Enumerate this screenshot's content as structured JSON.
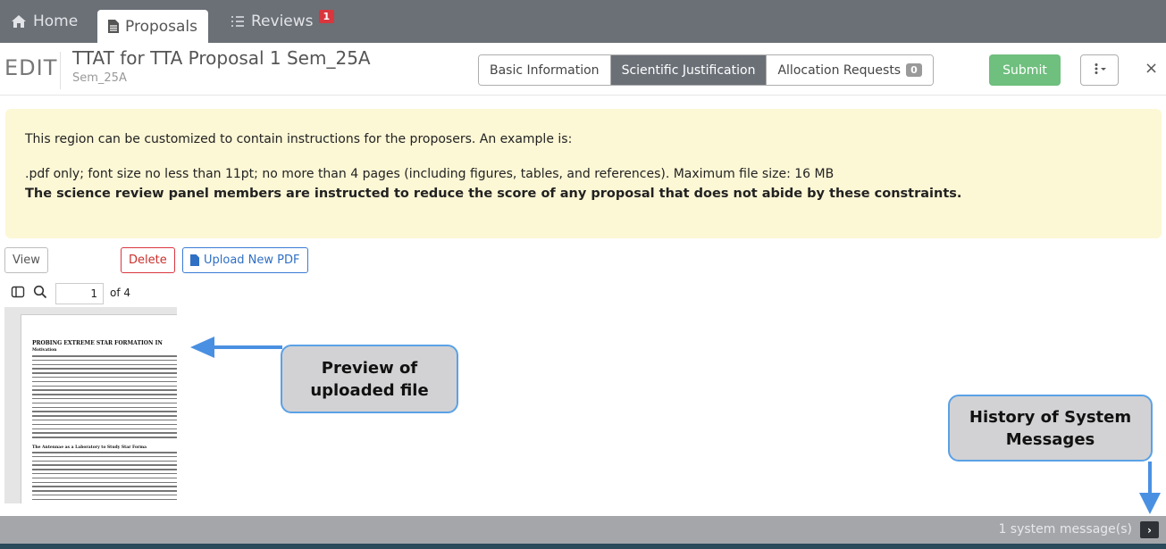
{
  "nav": {
    "tabs": [
      {
        "label": "Home",
        "icon": "home-icon"
      },
      {
        "label": "Proposals",
        "icon": "document-icon"
      },
      {
        "label": "Reviews",
        "icon": "list-icon",
        "badge": "1"
      }
    ]
  },
  "header": {
    "mode_label": "EDIT",
    "title": "TTAT for TTA Proposal 1 Sem_25A",
    "subtitle": "Sem_25A",
    "sections": [
      {
        "label": "Basic Information"
      },
      {
        "label": "Scientific Justification",
        "active": true
      },
      {
        "label": "Allocation Requests",
        "badge": "0"
      }
    ],
    "submit_label": "Submit",
    "close_symbol": "×"
  },
  "instructions": {
    "line1": "This region can be customized to contain instructions for the proposers. An example is:",
    "line2": ".pdf only; font size no less than 11pt; no more than 4 pages (including figures, tables, and references). Maximum file size: 16 MB",
    "line3": "The science review panel members are instructed to reduce the score of any proposal that does not abide by these constraints."
  },
  "actions": {
    "view_label": "View",
    "delete_label": "Delete",
    "upload_label": "Upload New PDF"
  },
  "pdf_viewer": {
    "current_page": "1",
    "page_count_label": "of 4",
    "preview": {
      "heading": "PROBING EXTREME STAR FORMATION IN",
      "section1": "Motivation",
      "section2": "The Antennae as a Laboratory to Study Star Forma"
    }
  },
  "annotations": {
    "preview_callout": "Preview of uploaded file",
    "history_callout": "History of System Messages",
    "arrow_color": "#4a90e2"
  },
  "status_bar": {
    "message": "1 system message(s)",
    "expand_symbol": "›"
  },
  "colors": {
    "nav_bg": "#6b7077",
    "instructions_bg": "#fcf7d5",
    "submit_bg": "#6fbf7e",
    "delete": "#d9363e",
    "upload": "#3a7bd5"
  }
}
